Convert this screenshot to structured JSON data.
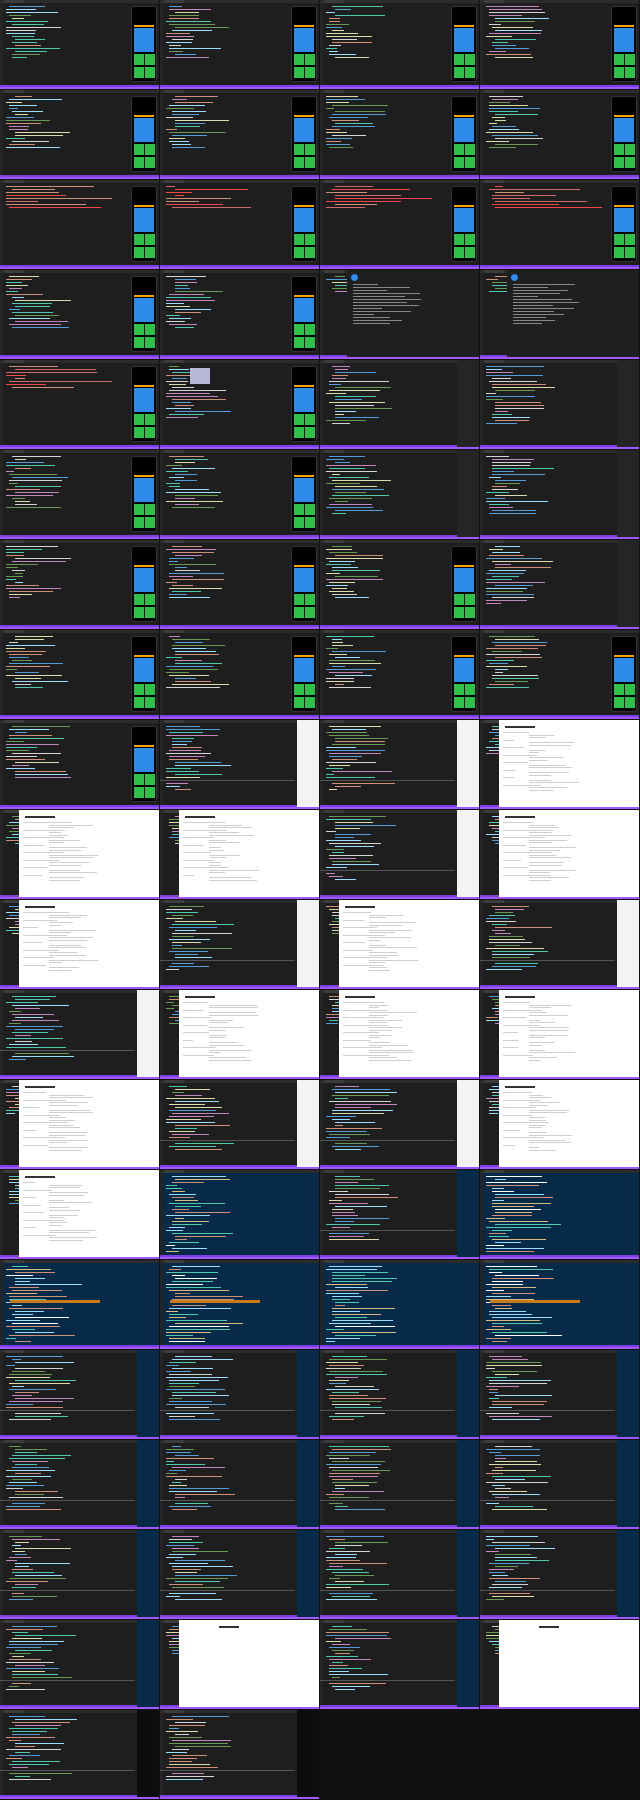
{
  "screen": {
    "title": "",
    "accent_color": "#a259ff",
    "editor_bg": "#1e1e1e",
    "sidebar_bg": "#f3f3f3",
    "phone_blue": "#2e8bea",
    "phone_green": "#2ec24a",
    "phone_orange": "#f4a300",
    "navy_bg": "#062a48"
  },
  "grid": {
    "columns": 4,
    "rows": 20,
    "tiles": [
      {
        "kind": "editor-phone"
      },
      {
        "kind": "editor-phone"
      },
      {
        "kind": "editor-phone"
      },
      {
        "kind": "editor-phone"
      },
      {
        "kind": "editor-phone"
      },
      {
        "kind": "editor-phone"
      },
      {
        "kind": "editor-phone"
      },
      {
        "kind": "editor-phone"
      },
      {
        "kind": "editor-phone-red"
      },
      {
        "kind": "editor-phone-red"
      },
      {
        "kind": "editor-phone-red"
      },
      {
        "kind": "editor-phone-red"
      },
      {
        "kind": "editor-phone"
      },
      {
        "kind": "editor-phone"
      },
      {
        "kind": "docs"
      },
      {
        "kind": "docs"
      },
      {
        "kind": "editor-phone-red"
      },
      {
        "kind": "editor-popup"
      },
      {
        "kind": "editor-split"
      },
      {
        "kind": "editor-split"
      },
      {
        "kind": "editor-phone"
      },
      {
        "kind": "editor-phone"
      },
      {
        "kind": "editor-split"
      },
      {
        "kind": "editor-split"
      },
      {
        "kind": "editor-phone"
      },
      {
        "kind": "editor-phone"
      },
      {
        "kind": "editor-phone"
      },
      {
        "kind": "editor-split"
      },
      {
        "kind": "editor-phone"
      },
      {
        "kind": "editor-phone"
      },
      {
        "kind": "editor-phone"
      },
      {
        "kind": "editor-phone"
      },
      {
        "kind": "editor-phone"
      },
      {
        "kind": "editor-white"
      },
      {
        "kind": "editor-white"
      },
      {
        "kind": "web"
      },
      {
        "kind": "web"
      },
      {
        "kind": "web"
      },
      {
        "kind": "editor-white"
      },
      {
        "kind": "web"
      },
      {
        "kind": "web"
      },
      {
        "kind": "editor-white"
      },
      {
        "kind": "web"
      },
      {
        "kind": "editor-white"
      },
      {
        "kind": "editor-white"
      },
      {
        "kind": "web"
      },
      {
        "kind": "web"
      },
      {
        "kind": "web"
      },
      {
        "kind": "web"
      },
      {
        "kind": "editor-white"
      },
      {
        "kind": "editor-white"
      },
      {
        "kind": "web"
      },
      {
        "kind": "web"
      },
      {
        "kind": "navy"
      },
      {
        "kind": "editor-navy"
      },
      {
        "kind": "navy"
      },
      {
        "kind": "navy-sel"
      },
      {
        "kind": "navy-sel"
      },
      {
        "kind": "navy"
      },
      {
        "kind": "navy-sel"
      },
      {
        "kind": "editor-navy"
      },
      {
        "kind": "editor-navy"
      },
      {
        "kind": "editor-navy"
      },
      {
        "kind": "editor-navy"
      },
      {
        "kind": "editor-navy"
      },
      {
        "kind": "editor-navy"
      },
      {
        "kind": "editor-navy"
      },
      {
        "kind": "editor-navy"
      },
      {
        "kind": "editor-navy"
      },
      {
        "kind": "editor-navy"
      },
      {
        "kind": "editor-navy"
      },
      {
        "kind": "editor-navy"
      },
      {
        "kind": "editor-navy"
      },
      {
        "kind": "web-blank"
      },
      {
        "kind": "editor-navy"
      },
      {
        "kind": "web-blank"
      },
      {
        "kind": "editor-dark"
      },
      {
        "kind": "editor-dark"
      },
      {
        "kind": "empty"
      },
      {
        "kind": "empty"
      }
    ]
  }
}
